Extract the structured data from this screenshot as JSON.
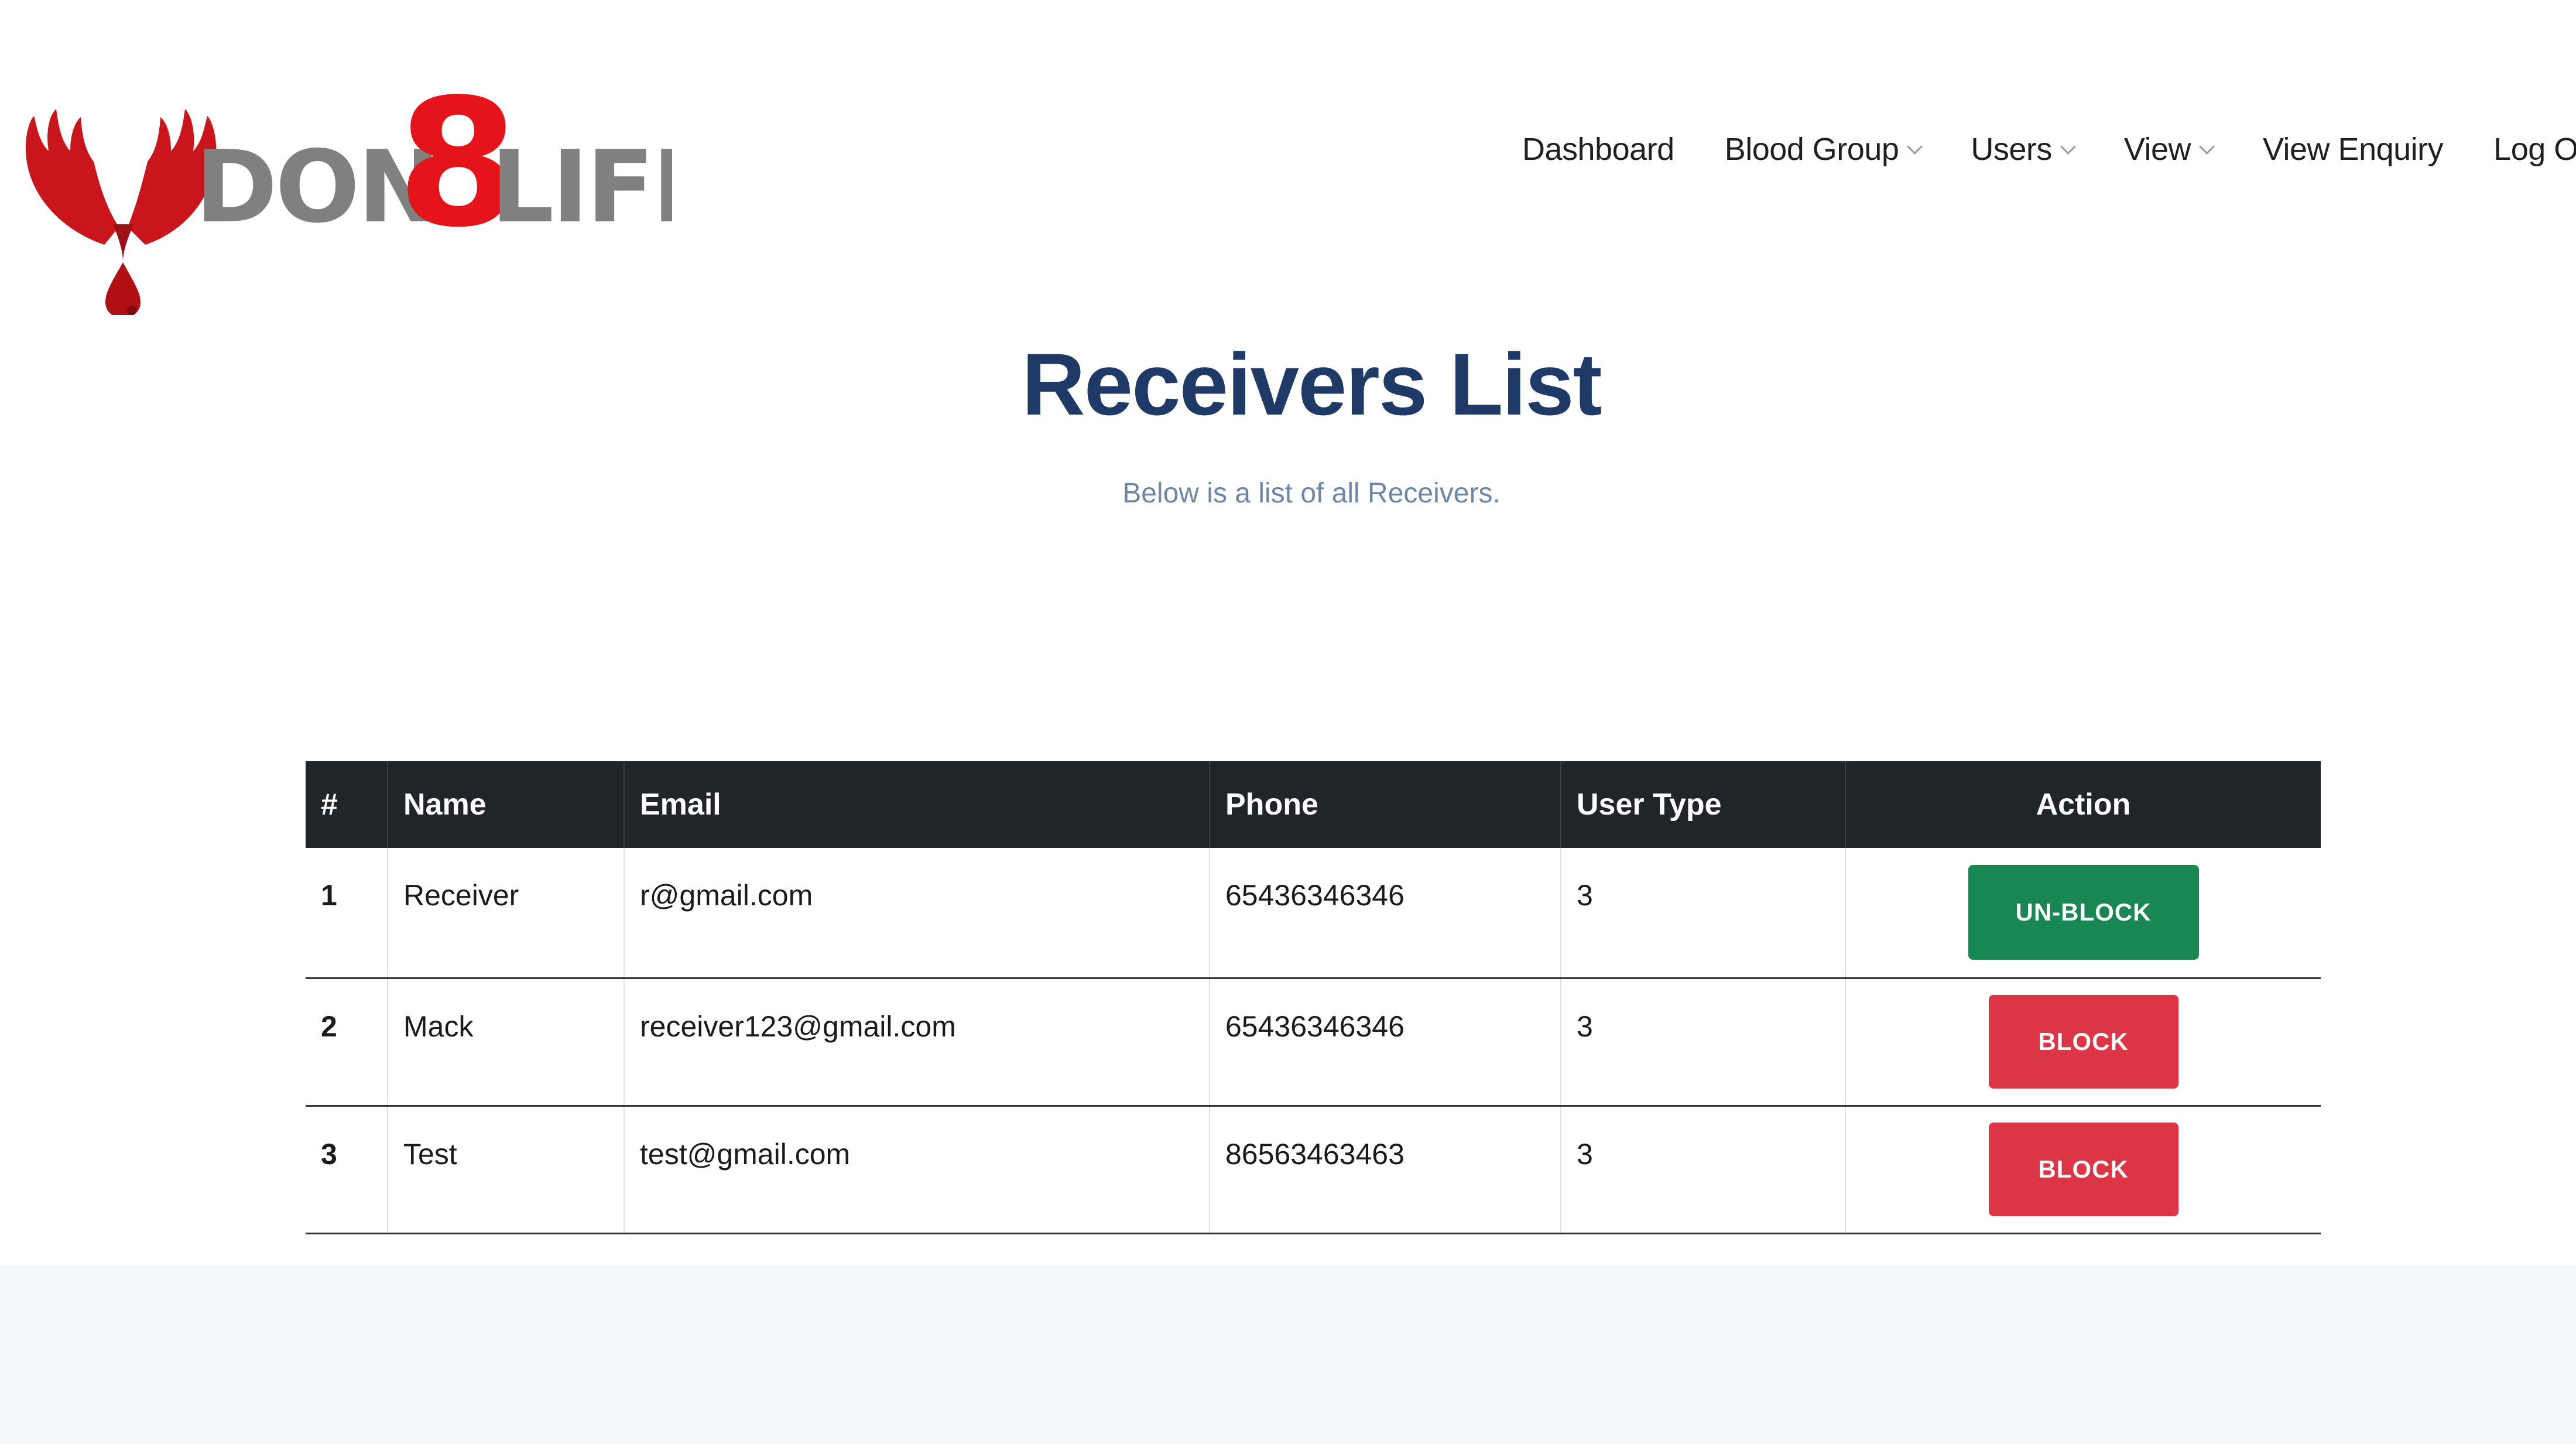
{
  "logo": {
    "text_part1": "DON",
    "text_digit": "8",
    "text_part2": "LIFE",
    "colors": {
      "red": "#d01015",
      "gray": "#808080",
      "dark_red": "#8b0f14"
    }
  },
  "nav": {
    "items": [
      {
        "label": "Dashboard",
        "has_dropdown": false
      },
      {
        "label": "Blood Group",
        "has_dropdown": true
      },
      {
        "label": "Users",
        "has_dropdown": true
      },
      {
        "label": "View",
        "has_dropdown": true
      },
      {
        "label": "View Enquiry",
        "has_dropdown": false
      },
      {
        "label": "Log Out",
        "has_dropdown": false
      }
    ]
  },
  "page": {
    "title": "Receivers List",
    "subtitle": "Below is a list of all Receivers."
  },
  "table": {
    "headers": [
      "#",
      "Name",
      "Email",
      "Phone",
      "User Type",
      "Action"
    ],
    "rows": [
      {
        "num": "1",
        "name": "Receiver",
        "email": "r@gmail.com",
        "phone": "65436346346",
        "user_type": "3",
        "action": "UN-BLOCK"
      },
      {
        "num": "2",
        "name": "Mack",
        "email": "receiver123@gmail.com",
        "phone": "65436346346",
        "user_type": "3",
        "action": "BLOCK"
      },
      {
        "num": "3",
        "name": "Test",
        "email": "test@gmail.com",
        "phone": "86563463463",
        "user_type": "3",
        "action": "BLOCK"
      }
    ]
  },
  "colors": {
    "title": "#1f3a66",
    "subtitle": "#6c86a6",
    "table_header_bg": "#212529",
    "unblock_button": "#198754",
    "block_button": "#dc3545",
    "footer_band": "#f3f7f9"
  }
}
